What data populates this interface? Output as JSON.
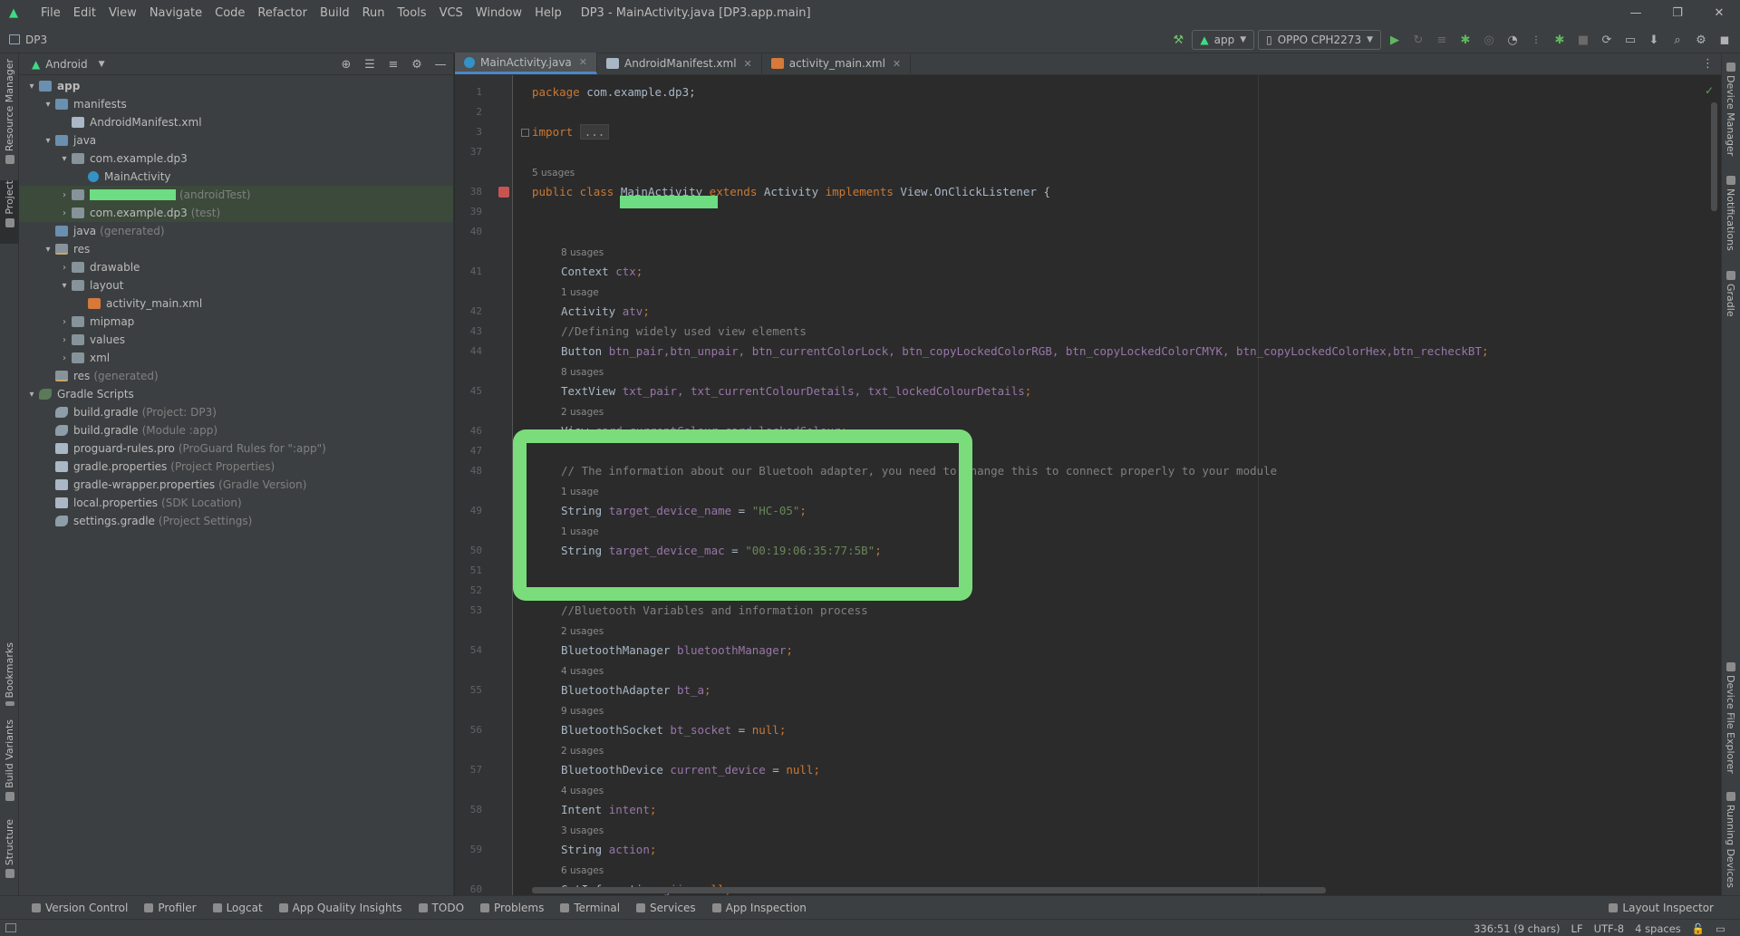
{
  "window": {
    "title": "DP3 - MainActivity.java [DP3.app.main]",
    "menu": [
      "File",
      "Edit",
      "View",
      "Navigate",
      "Code",
      "Refactor",
      "Build",
      "Run",
      "Tools",
      "VCS",
      "Window",
      "Help"
    ]
  },
  "nav": {
    "project_name": "DP3",
    "run_config": "app",
    "device": "OPPO CPH2273"
  },
  "left_strip": {
    "resource_manager": "Resource Manager",
    "project": "Project",
    "bookmarks": "Bookmarks",
    "build_variants": "Build Variants",
    "structure": "Structure"
  },
  "right_strip": {
    "device_manager": "Device Manager",
    "notifications": "Notifications",
    "gradle": "Gradle",
    "device_file_explorer": "Device File Explorer",
    "running_devices": "Running Devices"
  },
  "project_panel": {
    "view_mode": "Android",
    "tree": {
      "app": "app",
      "manifests": "manifests",
      "android_manifest": "AndroidManifest.xml",
      "java": "java",
      "pkg_main": "com.example.dp3",
      "main_activity": "MainActivity",
      "android_test_suffix": "(androidTest)",
      "pkg_test": "com.example.dp3",
      "test_suffix": "(test)",
      "java_generated": "java",
      "generated_suffix": "(generated)",
      "res": "res",
      "drawable": "drawable",
      "layout": "layout",
      "activity_main": "activity_main.xml",
      "mipmap": "mipmap",
      "values": "values",
      "xml": "xml",
      "res_generated": "res",
      "res_generated_suffix": "(generated)",
      "gradle_scripts": "Gradle Scripts",
      "build_gradle_project": "build.gradle",
      "build_gradle_project_suffix": "(Project: DP3)",
      "build_gradle_module": "build.gradle",
      "build_gradle_module_suffix": "(Module :app)",
      "proguard": "proguard-rules.pro",
      "proguard_suffix": "(ProGuard Rules for \":app\")",
      "gradle_properties": "gradle.properties",
      "gradle_properties_suffix": "(Project Properties)",
      "gradle_wrapper": "gradle-wrapper.properties",
      "gradle_wrapper_suffix": "(Gradle Version)",
      "local_properties": "local.properties",
      "local_properties_suffix": "(SDK Location)",
      "settings_gradle": "settings.gradle",
      "settings_gradle_suffix": "(Project Settings)"
    }
  },
  "editor": {
    "tabs": [
      {
        "label": "MainActivity.java"
      },
      {
        "label": "AndroidManifest.xml"
      },
      {
        "label": "activity_main.xml"
      }
    ],
    "line_numbers": {
      "l1": "1",
      "l2": "2",
      "l3": "3",
      "l37": "37",
      "l38": "38",
      "l39": "39",
      "l40": "40",
      "l41": "41",
      "l42": "42",
      "l43": "43",
      "l44": "44",
      "l45": "45",
      "l46": "46",
      "l47": "47",
      "l48": "48",
      "l49": "49",
      "l50": "50",
      "l51": "51",
      "l52": "52",
      "l53": "53",
      "l54": "54",
      "l55": "55",
      "l56": "56",
      "l57": "57",
      "l58": "58",
      "l59": "59",
      "l60": "60"
    },
    "usages": {
      "u38": "5 usages",
      "u41": "8 usages",
      "u42": "1 usage",
      "u45": "8 usages",
      "u46": "2 usages",
      "u49": "1 usage",
      "u50": "1 usage",
      "u54": "2 usages",
      "u55": "4 usages",
      "u56": "9 usages",
      "u57": "2 usages",
      "u58": "4 usages",
      "u59": "3 usages",
      "u60": "6 usages"
    },
    "code": {
      "c1_kw": "package",
      "c1_rest": " com.example.dp3;",
      "c3_kw": "import",
      "c3_fold": "...",
      "c38_kw1": "public class",
      "c38_name": " MainActivity ",
      "c38_kw2": "extends",
      "c38_mid": " Activity ",
      "c38_kw3": "implements",
      "c38_rest": " View.OnClickListener {",
      "c41_type": "Context ",
      "c41_field": "ctx",
      "c41_end": ";",
      "c42_type": "Activity ",
      "c42_field": "atv",
      "c42_end": ";",
      "c43": "//Defining widely used view elements",
      "c44_type": "Button ",
      "c44_fields": "btn_pair,btn_unpair, btn_currentColorLock, btn_copyLockedColorRGB, btn_copyLockedColorCMYK, btn_copyLockedColorHex,btn_recheckBT",
      "c44_end": ";",
      "c45_type": "TextView ",
      "c45_fields": "txt_pair, txt_currentColourDetails, txt_lockedColourDetails",
      "c45_end": ";",
      "c46_type": "View ",
      "c46_fields": "card_currentColour,card_lockedColour",
      "c46_end": ";",
      "c48": "// The information about our Bluetooh adapter, you need to change this to connect properly to your module",
      "c49_type": "String ",
      "c49_field": "target_device_name",
      "c49_eq": " = ",
      "c49_str": "\"HC-05\"",
      "c49_end": ";",
      "c50_type": "String ",
      "c50_field": "target_device_mac",
      "c50_eq": " = ",
      "c50_str": "\"00:19:06:35:77:5B\"",
      "c50_end": ";",
      "c53": "//Bluetooth Variables and information process",
      "c54_type": "BluetoothManager ",
      "c54_field": "bluetoothManager",
      "c54_end": ";",
      "c55_type": "BluetoothAdapter ",
      "c55_field": "bt_a",
      "c55_end": ";",
      "c56_type": "BluetoothSocket ",
      "c56_field": "bt_socket",
      "c56_eq": " = ",
      "c56_null": "null",
      "c56_end": ";",
      "c57_type": "BluetoothDevice ",
      "c57_field": "current_device",
      "c57_eq": " = ",
      "c57_null": "null",
      "c57_end": ";",
      "c58_type": "Intent ",
      "c58_field": "intent",
      "c58_end": ";",
      "c59_type": "String ",
      "c59_field": "action",
      "c59_end": ";",
      "c60_type": "GetInformation ",
      "c60_field": "gii",
      "c60_eq": " =",
      "c60_null": "null",
      "c60_end": ";"
    }
  },
  "bottom_tools": [
    "Version Control",
    "Profiler",
    "Logcat",
    "App Quality Insights",
    "TODO",
    "Problems",
    "Terminal",
    "Services",
    "App Inspection"
  ],
  "layout_inspector": "Layout Inspector",
  "status": {
    "position": "336:51 (9 chars)",
    "line_sep": "LF",
    "encoding": "UTF-8",
    "indent": "4 spaces"
  },
  "colors": {
    "highlight": "#7bdc7c",
    "keyword": "#cc7832",
    "field": "#9876aa",
    "string": "#6a8759",
    "comment": "#808080"
  }
}
